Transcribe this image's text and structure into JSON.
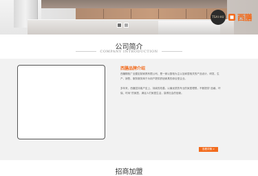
{
  "hero": {
    "badge_text": "TSAI·HU",
    "logo_text": "西膳",
    "slider_dots": 2,
    "brand_color": "#f26b1d"
  },
  "about": {
    "title": "公司简介",
    "subtitle": "COMPANY INTRODUCTION",
    "heading": "西膳品牌介绍",
    "para1": "西膳橱柜厂全屋定制家具有限公司，是一家以厨柜为主以及家居相关的产品设计、研发、生产、销售、服务服务商于为用户提供舒适家具的综合型企业。",
    "para2": "多年来，西膳坚持客户至上、持续的改善，以最优质的专业的家居理想，不断提供“品格、环保、时尚”的家居，满足人们家居生活，赢得社会的信赖。",
    "more_label": "查看详情 >"
  },
  "next_section": {
    "title": "招商加盟"
  }
}
